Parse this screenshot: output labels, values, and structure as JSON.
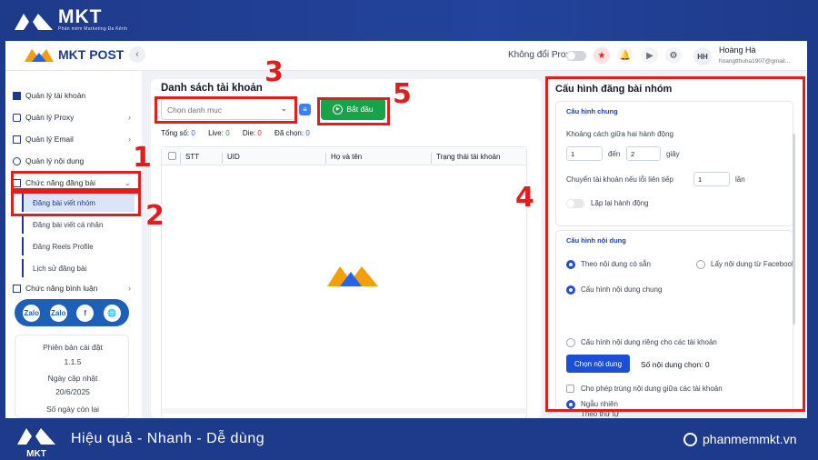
{
  "brand": {
    "name": "MKT",
    "tagline": "Phần mềm Marketing Đa Kênh"
  },
  "app": {
    "name": "MKT POST"
  },
  "header": {
    "proxy_label": "Không đổi Proxy",
    "avatar_initials": "HH",
    "user_name": "Hoàng Hà",
    "user_email": "hoangtthuha1907@gmail..."
  },
  "sidebar": {
    "items": [
      {
        "label": "Quản lý tài khoản"
      },
      {
        "label": "Quản lý Proxy"
      },
      {
        "label": "Quản lý Email"
      },
      {
        "label": "Quản lý nội dung"
      },
      {
        "label": "Chức năng đăng bài"
      },
      {
        "label": "Chức năng bình luận"
      }
    ],
    "subitems": [
      {
        "label": "Đăng bài viết nhóm"
      },
      {
        "label": "Đăng bài viết cá nhân"
      },
      {
        "label": "Đăng Reels Profile"
      },
      {
        "label": "Lịch sử đăng bài"
      }
    ],
    "social": [
      "Zalo",
      "Zalo",
      "f",
      "🌐"
    ],
    "version_label": "Phiên bản cài đặt",
    "version": "1.1.5",
    "update_label": "Ngày cập nhật",
    "update_date": "20/6/2025",
    "remaining_label": "Số ngày còn lại"
  },
  "main": {
    "title": "Danh sách tài khoản",
    "category_placeholder": "Chọn danh mục",
    "start_label": "Bắt đầu",
    "stats": {
      "total_label": "Tổng số:",
      "total": "0",
      "live_label": "Live:",
      "live": "0",
      "die_label": "Die:",
      "die": "0",
      "selected_label": "Đã chọn:",
      "selected": "0"
    },
    "columns": [
      "STT",
      "UID",
      "Họ và tên",
      "Trạng thái tài khoản"
    ]
  },
  "config": {
    "title": "Cấu hình đăng bài nhóm",
    "general_section": "Cấu hình chung",
    "interval_label": "Khoảng cách giữa hai hành động",
    "interval_from": "1",
    "interval_to_label": "đến",
    "interval_to": "2",
    "interval_unit": "giây",
    "switch_label": "Chuyển tài khoản nếu lỗi liên tiếp",
    "switch_value": "1",
    "switch_unit": "lần",
    "repeat_label": "Lặp lại hành động",
    "content_section": "Cấu hình nội dung",
    "opt_available": "Theo nội dung có sẵn",
    "opt_facebook": "Lấy nội dung từ Facebook",
    "opt_common": "Cấu hình nội dung chung",
    "opt_private": "Cấu hình nội dung riêng cho các tài khoản",
    "choose_button": "Chọn nội dung",
    "selected_count": "Số nội dung chọn: 0",
    "allow_duplicate": "Cho phép trùng nội dung giữa các tài khoản",
    "random_label": "Ngẫu nhiên",
    "order_label": "Theo thứ tự"
  },
  "annotations": [
    "1",
    "2",
    "3",
    "4",
    "5"
  ],
  "footer": {
    "slogan": "Hiệu quả - Nhanh  - Dễ dùng",
    "website": "phanmemmkt.vn",
    "logo_text": "MKT"
  },
  "colors": {
    "brand_blue": "#1e3a8a",
    "highlight_red": "#e11d1d",
    "start_green": "#16a34a"
  }
}
